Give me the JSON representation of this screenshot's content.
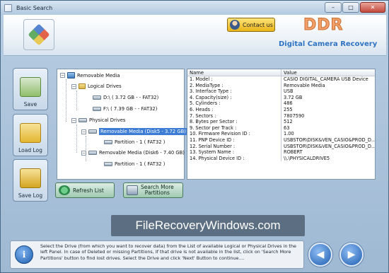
{
  "window": {
    "title": "Basic Search",
    "controls": {
      "minimize": "–",
      "maximize": "□",
      "close": "✕"
    }
  },
  "header": {
    "contact_label": "Contact us",
    "brand": "DDR",
    "product": "Digital Camera Recovery",
    "logo_icon": "checker-logo-icon"
  },
  "sidebar": {
    "save": "Save",
    "load_log": "Load Log",
    "save_log": "Save Log"
  },
  "tree": {
    "root": "Removable Media",
    "logical": "Logical Drives",
    "logical_items": [
      "D:\\ ( 3.72 GB - - FAT32)",
      "F:\\ ( 7.39 GB - - FAT32)"
    ],
    "physical": "Physical Drives",
    "disk5": "Removable Media (Disk5 - 3.72 GB)",
    "disk5_part": "Partition - 1 ( FAT32 )",
    "disk6": "Removable Media (Disk6 - 7.40 GB)",
    "disk6_part": "Partition - 1 ( FAT32 )"
  },
  "properties": {
    "col_name": "Name",
    "col_value": "Value",
    "rows": [
      [
        "1. Model :",
        "CASIO DIGITAL_CAMERA USB Device"
      ],
      [
        "2. MediaType :",
        "Removable Media"
      ],
      [
        "3. Interface Type :",
        "USB"
      ],
      [
        "4. Capacity(size) :",
        "3.72 GB"
      ],
      [
        "5. Cylinders :",
        "486"
      ],
      [
        "6. Heads :",
        "255"
      ],
      [
        "7. Sectors :",
        "7807590"
      ],
      [
        "8. Bytes per Sector :",
        "512"
      ],
      [
        "9. Sector per Track :",
        "63"
      ],
      [
        "10. Firmware Revision ID :",
        "1.00"
      ],
      [
        "11. PNP Device ID :",
        "USBSTOR\\DISK&VEN_CASIO&PROD_D..."
      ],
      [
        "12. Serial Number :",
        "USBSTOR\\DISK&VEN_CASIO&PROD_D..."
      ],
      [
        "13. System Name :",
        "ROBERT"
      ],
      [
        "14. Physical Device ID :",
        "\\\\.\\PHYSICALDRIVE5"
      ]
    ]
  },
  "actions": {
    "refresh": "Refresh List",
    "search_more_1": "Search More",
    "search_more_2": "Partitions"
  },
  "watermark": "FileRecoveryWindows.com",
  "info": {
    "text": "Select the Drive (from which you want to recover data) from the List of available Logical or Physical Drives in the left Panel. In case of Deleted or missing Partitions, If that drive is not available in the list, click on 'Search More Partitions' button to find lost drives. Select the Drive and click 'Next' Button to continue...."
  },
  "nav": {
    "back": "◀",
    "next": "▶"
  }
}
